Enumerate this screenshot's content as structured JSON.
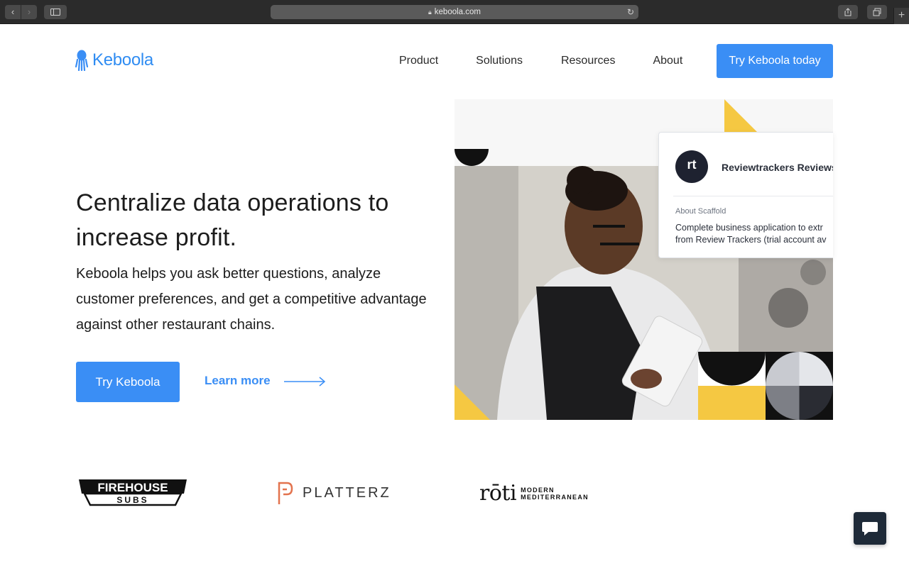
{
  "browser": {
    "url": "keboola.com",
    "back_icon": "chevron-left-icon",
    "forward_icon": "chevron-right-icon",
    "reload_icon": "reload-icon",
    "new_tab_label": "+"
  },
  "header": {
    "brand": "Keboola",
    "nav": [
      "Product",
      "Solutions",
      "Resources",
      "About"
    ],
    "cta": "Try Keboola today"
  },
  "hero": {
    "title": "Centralize data operations to increase profit.",
    "subtitle": "Keboola helps you ask better questions, analyze customer preferences, and get a competitive advantage against other restaurant chains.",
    "primary_button": "Try Keboola",
    "secondary_link": "Learn more"
  },
  "card": {
    "avatar_text": "rt",
    "title": "Reviewtrackers Reviews",
    "label": "About Scaffold",
    "description_line1": "Complete business application to extr",
    "description_line2": "from Review Trackers (trial account av"
  },
  "customers": {
    "firehouse_top": "FIREHOUSE",
    "firehouse_bottom": "SUBS",
    "platterz": "PLATTERZ",
    "roti": "rōti",
    "roti_sub1": "MODERN",
    "roti_sub2": "MEDITERRANEAN"
  },
  "colors": {
    "brand_blue": "#3a8ef5",
    "accent_yellow": "#f5c842",
    "dark": "#1e2a38"
  }
}
